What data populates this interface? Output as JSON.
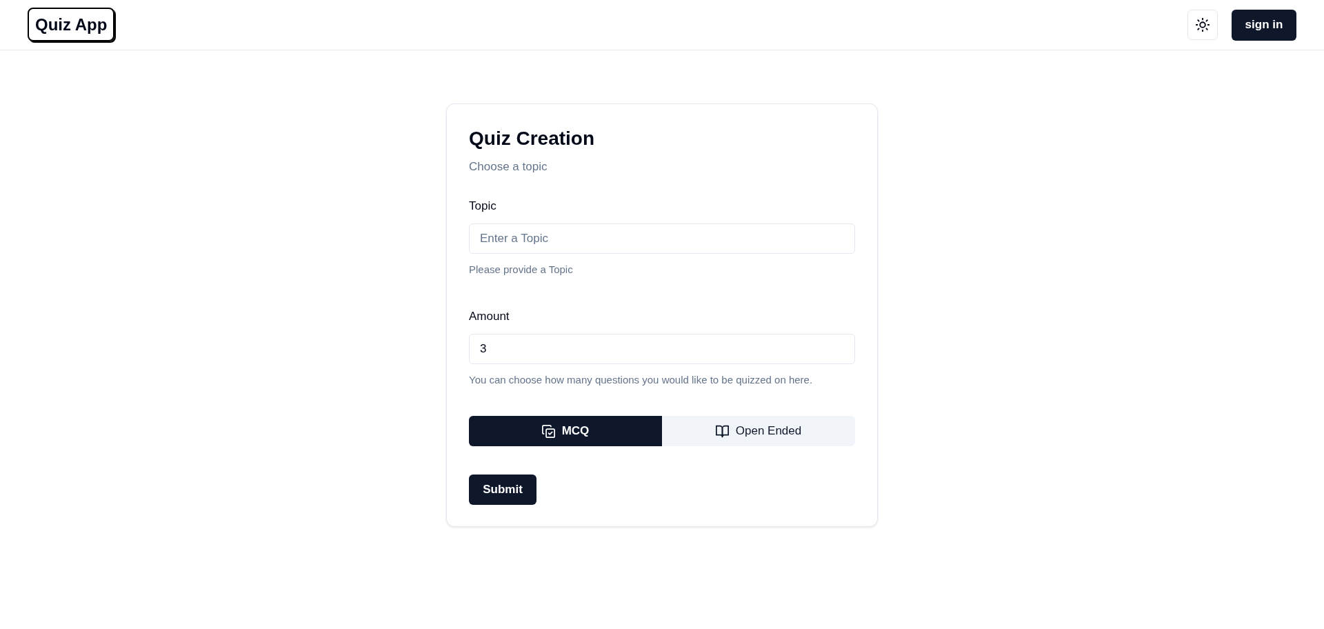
{
  "header": {
    "logo": "Quiz App",
    "sign_in": "sign in"
  },
  "card": {
    "title": "Quiz Creation",
    "description": "Choose a topic",
    "fields": [
      {
        "label": "Topic",
        "placeholder": "Enter a Topic",
        "helper": "Please provide a Topic"
      },
      {
        "label": "Amount",
        "value": "3",
        "helper": "You can choose how many questions you would like to be quizzed on here."
      }
    ],
    "quiz_types": [
      {
        "label": "MCQ",
        "selected": true
      },
      {
        "label": "Open Ended",
        "selected": false
      }
    ],
    "submit": "Submit"
  }
}
